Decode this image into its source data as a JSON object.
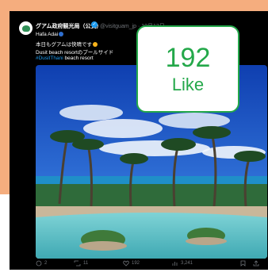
{
  "header": {
    "account_name": "グアム政府観光局（公式）",
    "handle": "@visitguam_jp · 10月13日"
  },
  "tweet": {
    "line1": "Hafa Adai",
    "line2": "本日もグアムは快晴です",
    "line3": "Dusit beach resortのプールサイド",
    "hashtag": "#DusitThani",
    "line4_rest": " beach resort"
  },
  "actions": {
    "replies": "2",
    "retweets": "11",
    "likes": "192",
    "views": "3,241"
  },
  "callout": {
    "count": "192",
    "label": "Like"
  },
  "icons": {
    "reply": "reply-icon",
    "retweet": "retweet-icon",
    "like": "heart-icon",
    "views": "views-icon",
    "bookmark": "bookmark-icon",
    "share": "share-icon"
  },
  "colors": {
    "background_accent": "#f5ad7e",
    "callout_green": "#24a84a",
    "link_blue": "#1d9bf0"
  }
}
